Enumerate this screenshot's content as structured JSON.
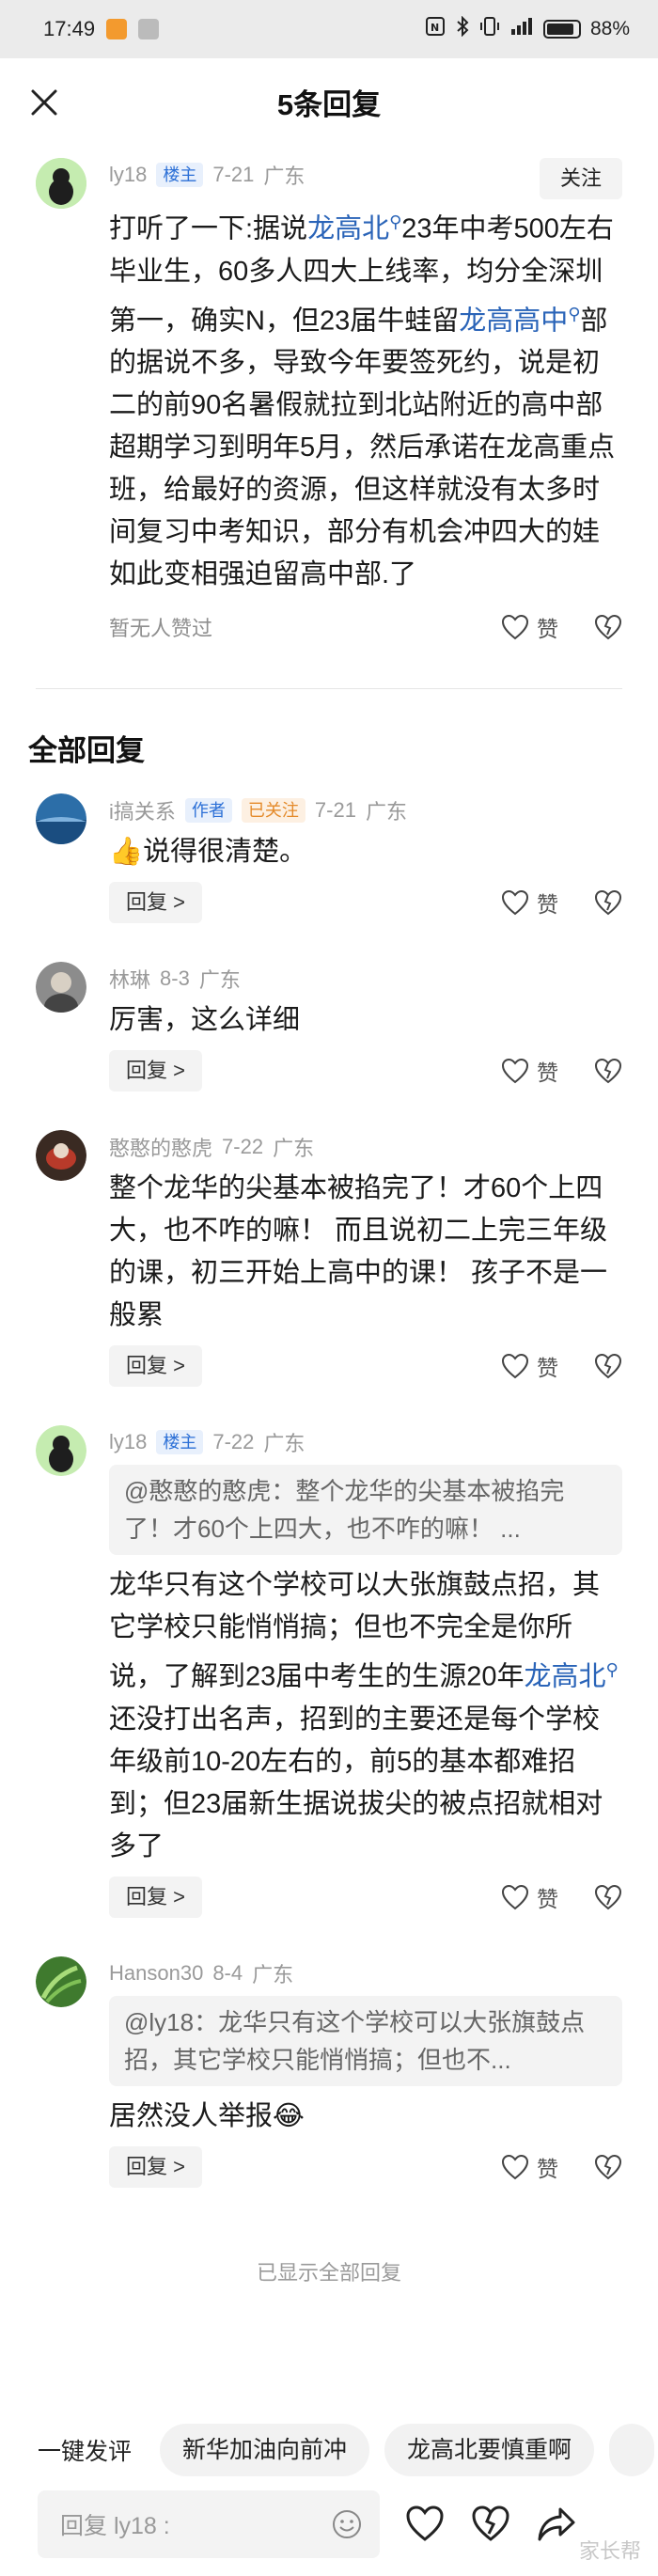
{
  "status_bar": {
    "time": "17:49",
    "battery": "88%"
  },
  "header": {
    "title": "5条回复"
  },
  "main_comment": {
    "user": "ly18",
    "tag": "楼主",
    "date": "7-21",
    "location": "广东",
    "follow_label": "关注",
    "text_parts": [
      "打听了一下:据说",
      "龙高北",
      "23年中考500左右毕业生，60多人四大上线率，均分全深圳第一，确实N，但23届牛蛙留",
      "龙高高中",
      "部的据说不多，导致今年要签死约，说是初二的前90名暑假就拉到北站附近的高中部超期学习到明年5月，然后承诺在龙高重点班，给最好的资源，但这样就没有太多时间复习中考知识，部分有机会冲四大的娃如此变相强迫留高中部.了"
    ],
    "likes_note": "暂无人赞过",
    "like_label": "赞"
  },
  "section": {
    "title": "全部回复"
  },
  "replies": [
    {
      "user": "i搞关系",
      "tags": [
        "作者",
        "已关注"
      ],
      "date": "7-21",
      "location": "广东",
      "text": "说得很清楚。",
      "reply_label": "回复 >",
      "like_label": "赞"
    },
    {
      "user": "林琳",
      "date": "8-3",
      "location": "广东",
      "text": "厉害，这么详细",
      "reply_label": "回复 >",
      "like_label": "赞"
    },
    {
      "user": "憨憨的憨虎",
      "date": "7-22",
      "location": "广东",
      "text": "整个龙华的尖基本被掐完了！才60个上四大，也不咋的嘛！ 而且说初二上完三年级的课，初三开始上高中的课！ 孩子不是一般累",
      "reply_label": "回复 >",
      "like_label": "赞"
    },
    {
      "user": "ly18",
      "tag": "楼主",
      "date": "7-22",
      "location": "广东",
      "quote": "@憨憨的憨虎：整个龙华的尖基本被掐完了！才60个上四大，也不咋的嘛！ ...",
      "text_parts": [
        "龙华只有这个学校可以大张旗鼓点招，其它学校只能悄悄搞；但也不完全是你所说，了解到23届中考生的生源20年",
        "龙高北",
        "还没打出名声，招到的主要还是每个学校年级前10-20左右的，前5的基本都难招到；但23届新生据说拔尖的被点招就相对多了"
      ],
      "reply_label": "回复 >",
      "like_label": "赞"
    },
    {
      "user": "Hanson30",
      "date": "8-4",
      "location": "广东",
      "quote": "@ly18：龙华只有这个学校可以大张旗鼓点招，其它学校只能悄悄搞；但也不...",
      "text": "居然没人举报",
      "reply_label": "回复 >",
      "like_label": "赞"
    }
  ],
  "footer_note": "已显示全部回复",
  "quick_bar": {
    "label": "一键发评",
    "chips": [
      "新华加油向前冲",
      "龙高北要慎重啊"
    ]
  },
  "input": {
    "placeholder": "回复 ly18 :"
  },
  "watermark": "家长帮"
}
